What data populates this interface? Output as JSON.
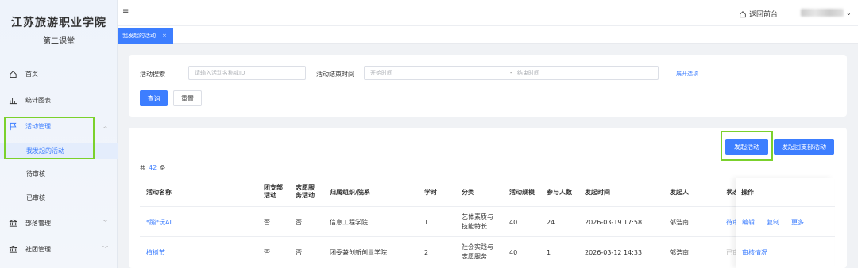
{
  "sidebar": {
    "brand_title": "江苏旅游职业学院",
    "brand_sub": "第二课堂",
    "items": [
      {
        "label": "首页",
        "icon": "home-icon"
      },
      {
        "label": "统计图表",
        "icon": "chart-icon"
      },
      {
        "label": "活动管理",
        "icon": "flag-icon",
        "expanded": true
      },
      {
        "label": "部落管理",
        "icon": "bank-icon"
      },
      {
        "label": "社团管理",
        "icon": "bank-icon"
      }
    ],
    "sub_items": [
      {
        "label": "我发起的活动",
        "active": true
      },
      {
        "label": "待审核"
      },
      {
        "label": "已审核"
      }
    ]
  },
  "header": {
    "back_label": "返回前台"
  },
  "tabs": [
    {
      "label": "我发起的活动",
      "close": "×"
    }
  ],
  "search": {
    "activity_label": "活动搜索",
    "activity_placeholder": "请输入活动名称或ID",
    "end_time_label": "活动结束时间",
    "start_placeholder": "开始时间",
    "range_sep": "-",
    "end_placeholder": "结束时间",
    "expand_label": "展开选项",
    "query_label": "查询",
    "reset_label": "重置"
  },
  "actions": {
    "launch_label": "发起活动",
    "launch_branch_label": "发起团支部活动"
  },
  "table": {
    "total_prefix": "共",
    "total_count": "42",
    "total_suffix": "条",
    "headers": {
      "name": "活动名称",
      "branch": "团支部\n活动",
      "volunteer": "志愿服\n务活动",
      "org": "归属组织/院系",
      "hours": "学时",
      "category": "分类",
      "scale": "活动规模",
      "participants": "参与人数",
      "launch_time": "发起时间",
      "launcher": "发起人",
      "status": "状态",
      "ops": "操作"
    },
    "rows": [
      {
        "name": "*蹦*玩AI",
        "branch": "否",
        "volunteer": "否",
        "org": "信息工程学院",
        "hours": "1",
        "category": "艺体素质与\n技能特长",
        "scale": "40",
        "participants": "24",
        "launch_time": "2026-03-19 17:58",
        "launcher": "郁浩南",
        "status": "待审",
        "ops": [
          "编辑",
          "复制",
          "更多"
        ]
      },
      {
        "name": "植树节",
        "branch": "否",
        "volunteer": "否",
        "org": "团委兼创新创业学院",
        "hours": "2",
        "category": "社会实践与\n志愿服务",
        "scale": "40",
        "participants": "1",
        "launch_time": "2026-03-12 14:33",
        "launcher": "郁浩南",
        "status": "已审",
        "ops": [
          "审核情况"
        ]
      }
    ]
  },
  "colors": {
    "primary": "#3d7eff",
    "highlight": "#7bd12c"
  }
}
